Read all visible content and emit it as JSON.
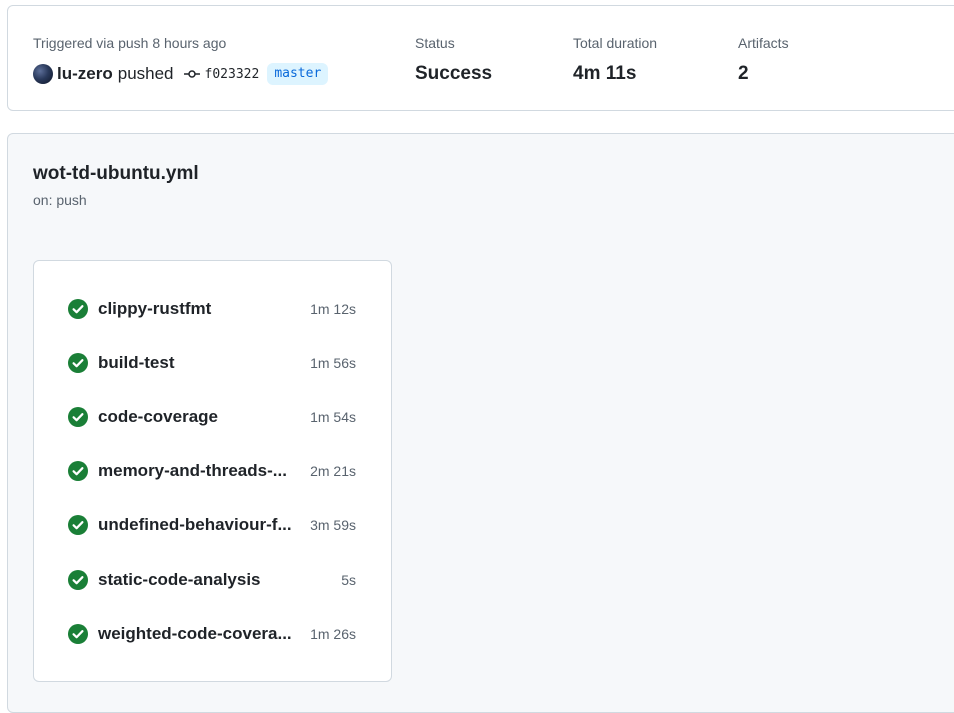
{
  "summary": {
    "trigger_label": "Triggered via push 8 hours ago",
    "actor": "lu-zero",
    "action": "pushed",
    "commit_sha": "f023322",
    "branch": "master",
    "status_label": "Status",
    "status_value": "Success",
    "duration_label": "Total duration",
    "duration_value": "4m 11s",
    "artifacts_label": "Artifacts",
    "artifacts_value": "2"
  },
  "workflow": {
    "name": "wot-td-ubuntu.yml",
    "event": "on: push",
    "jobs": [
      {
        "name": "clippy-rustfmt",
        "duration": "1m 12s",
        "status": "success"
      },
      {
        "name": "build-test",
        "duration": "1m 56s",
        "status": "success"
      },
      {
        "name": "code-coverage",
        "duration": "1m 54s",
        "status": "success"
      },
      {
        "name": "memory-and-threads-...",
        "duration": "2m 21s",
        "status": "success"
      },
      {
        "name": "undefined-behaviour-f...",
        "duration": "3m 59s",
        "status": "success"
      },
      {
        "name": "static-code-analysis",
        "duration": "5s",
        "status": "success"
      },
      {
        "name": "weighted-code-covera...",
        "duration": "1m 26s",
        "status": "success"
      }
    ]
  },
  "colors": {
    "success": "#1a7f37",
    "branch_bg": "#ddf4ff",
    "branch_fg": "#0969da",
    "panel_bg": "#f6f8fa",
    "border": "#d1d9e0"
  },
  "icons": {
    "commit": "git-commit-icon",
    "job_status": "check-circle-fill-icon"
  }
}
